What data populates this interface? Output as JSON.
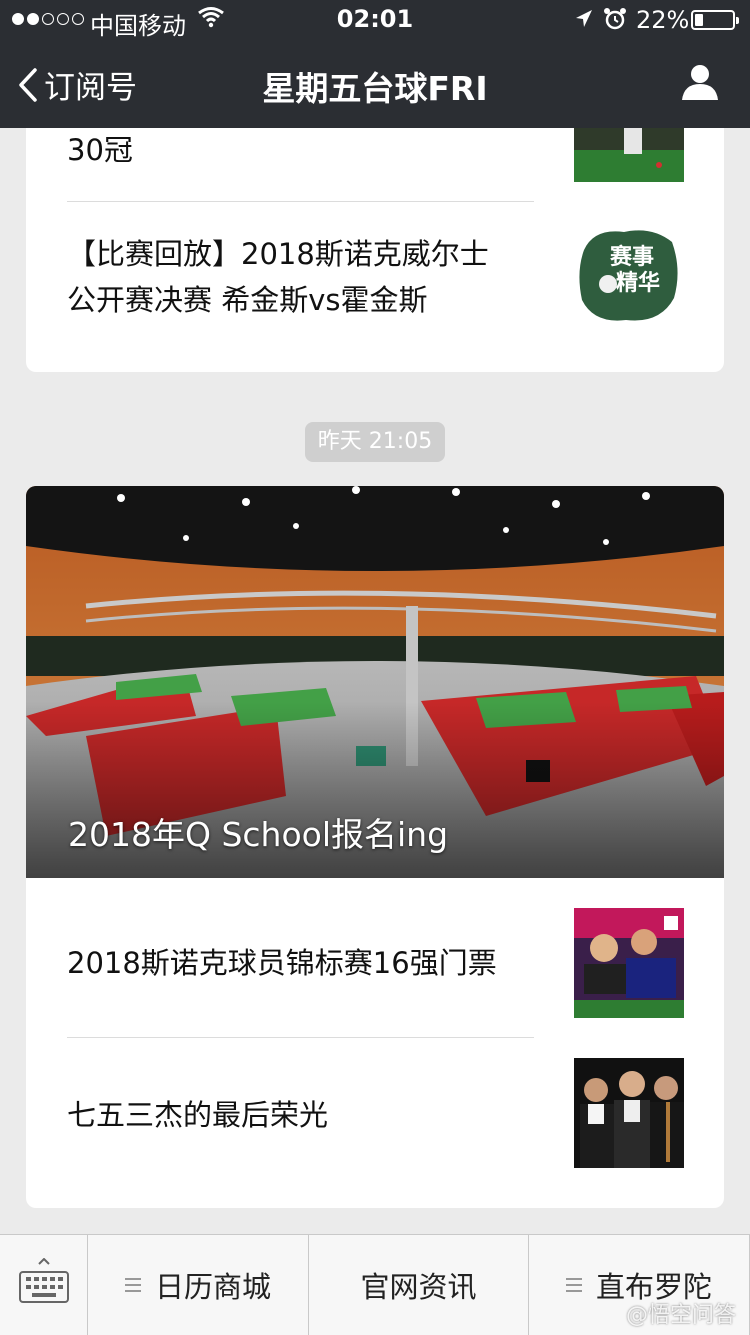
{
  "status_bar": {
    "carrier": "中国移动",
    "time": "02:01",
    "battery_percent": "22%",
    "battery_level": 0.22
  },
  "nav": {
    "back_label": "订阅号",
    "title": "星期五台球FRI"
  },
  "card1": {
    "partial_item_title": "30冠",
    "item_title_line1": "【比赛回放】2018斯诺克威尔士",
    "item_title_line2": "公开赛决赛 希金斯vs霍金斯",
    "thumb_stamp_line1": "赛事",
    "thumb_stamp_line2": "精华"
  },
  "timestamp": "昨天 21:05",
  "card2": {
    "hero_title": "2018年Q School报名ing",
    "items": [
      {
        "title": "2018斯诺克球员锦标赛16强门票"
      },
      {
        "title": "七五三杰的最后荣光"
      }
    ]
  },
  "bottom_menu": {
    "items": [
      {
        "label": "日历商城"
      },
      {
        "label": "官网资讯"
      },
      {
        "label": "直布罗陀"
      }
    ],
    "watermark": "@悟空问答"
  },
  "colors": {
    "nav_bg": "#2b2e33",
    "page_bg": "#ebebeb",
    "card_bg": "#ffffff",
    "badge_bg": "#cfcfcf"
  }
}
